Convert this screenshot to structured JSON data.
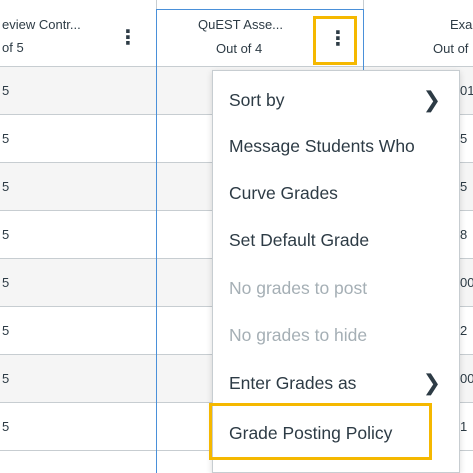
{
  "columns": [
    {
      "title": "eview Contr...",
      "subtitle": "of 5"
    },
    {
      "title": "QuEST Asse...",
      "subtitle": "Out of 4"
    },
    {
      "title": "Exar",
      "subtitle": "Out of"
    }
  ],
  "kebab_glyph": "⋮",
  "rows_left": [
    "5",
    "5",
    "5",
    "5",
    "5",
    "5",
    "5",
    "5"
  ],
  "rows_right": [
    "01",
    "5",
    "5",
    "8",
    "00",
    "2",
    "00",
    "1"
  ],
  "menu": {
    "items": [
      {
        "label": "Sort by",
        "enabled": true,
        "submenu": true
      },
      {
        "label": "Message Students Who",
        "enabled": true,
        "submenu": false
      },
      {
        "label": "Curve Grades",
        "enabled": true,
        "submenu": false
      },
      {
        "label": "Set Default Grade",
        "enabled": true,
        "submenu": false
      },
      {
        "label": "No grades to post",
        "enabled": false,
        "submenu": false
      },
      {
        "label": "No grades to hide",
        "enabled": false,
        "submenu": false
      },
      {
        "label": "Enter Grades as",
        "enabled": true,
        "submenu": true
      },
      {
        "label": "Grade Posting Policy",
        "enabled": true,
        "submenu": false
      }
    ],
    "chevron_glyph": "❯"
  },
  "colors": {
    "highlight": "#f5b800",
    "active_border": "#4a90d9",
    "text": "#2d3b45",
    "disabled_text": "#a5afb5"
  }
}
